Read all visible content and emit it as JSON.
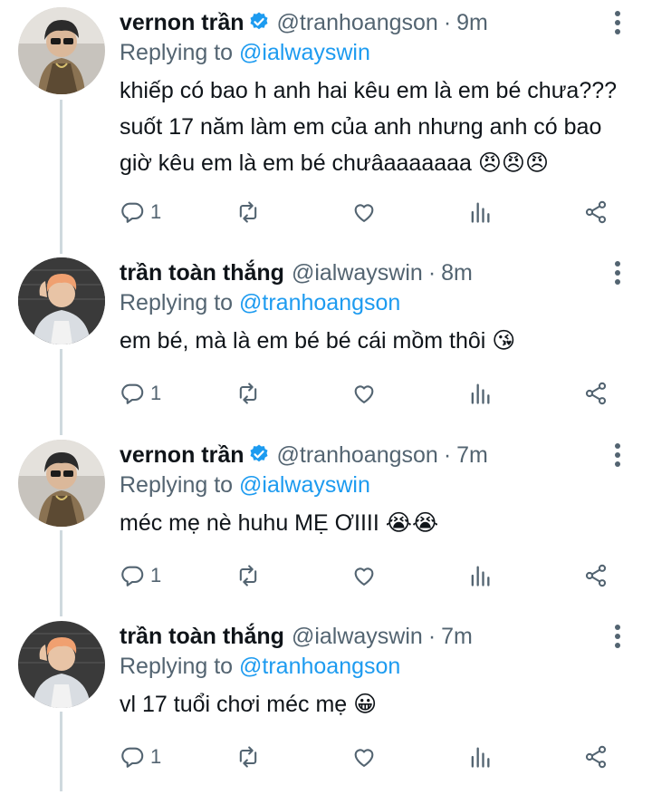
{
  "tweets": [
    {
      "name": "vernon trần",
      "verified": true,
      "handle": "@tranhoangson",
      "time": "9m",
      "replying_prefix": "Replying to",
      "replying_to": "@ialwayswin",
      "text": "khiếp có bao h anh hai kêu em là em bé chưa??? suốt 17 năm làm em của anh nhưng anh có bao giờ kêu em là em bé chưâaaaaaaa 😠😠😠",
      "reply_count": "1",
      "avatar_icon": "avatar-vernon"
    },
    {
      "name": "trần toàn thắng",
      "verified": false,
      "handle": "@ialwayswin",
      "time": "8m",
      "replying_prefix": "Replying to",
      "replying_to": "@tranhoangson",
      "text": "em bé, mà là em bé bé cái mồm thôi 😘",
      "reply_count": "1",
      "avatar_icon": "avatar-thang"
    },
    {
      "name": "vernon trần",
      "verified": true,
      "handle": "@tranhoangson",
      "time": "7m",
      "replying_prefix": "Replying to",
      "replying_to": "@ialwayswin",
      "text": "méc mẹ nè huhu MẸ ƠIIII 😭😭",
      "reply_count": "1",
      "avatar_icon": "avatar-vernon"
    },
    {
      "name": "trần toàn thắng",
      "verified": false,
      "handle": "@ialwayswin",
      "time": "7m",
      "replying_prefix": "Replying to",
      "replying_to": "@tranhoangson",
      "text": "vl 17 tuổi chơi méc mẹ 😀",
      "reply_count": "1",
      "avatar_icon": "avatar-thang"
    }
  ],
  "colors": {
    "accent": "#1d9bf0",
    "secondary_text": "#536471",
    "primary_text": "#0f1419",
    "thread_line": "#cfd9de"
  },
  "icons": [
    "reply-icon",
    "retweet-icon",
    "like-icon",
    "analytics-icon",
    "share-icon",
    "more-icon",
    "verified-badge-icon"
  ]
}
